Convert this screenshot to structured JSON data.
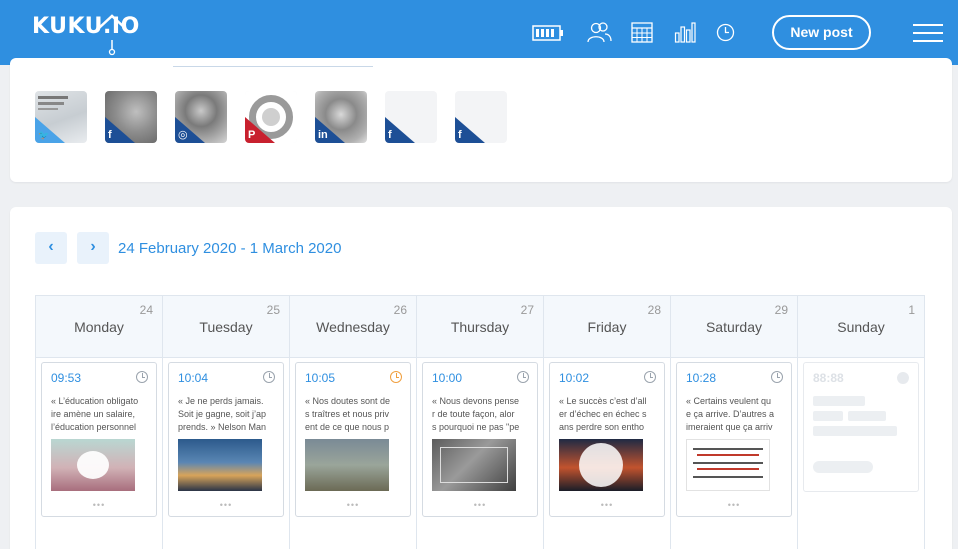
{
  "header": {
    "logo": "KUKU.IO",
    "nav_icons": [
      "battery-icon",
      "users-icon",
      "calendar-icon",
      "analytics-icon",
      "clock-icon"
    ],
    "new_post_label": "New post",
    "menu_icon": "hamburger-icon",
    "color": "#2f8fe0"
  },
  "accounts": [
    {
      "network": "twitter",
      "glyph": "🐦",
      "color": "#4aa3e8",
      "has_photo": true
    },
    {
      "network": "facebook",
      "glyph": "f",
      "color": "#1d4f96",
      "has_photo": true
    },
    {
      "network": "instagram",
      "glyph": "◎",
      "color": "#1d4f96",
      "has_photo": true
    },
    {
      "network": "pinterest",
      "glyph": "P",
      "color": "#c8202e",
      "has_photo": true
    },
    {
      "network": "linkedin",
      "glyph": "in",
      "color": "#1d4f96",
      "has_photo": true
    },
    {
      "network": "facebook",
      "glyph": "f",
      "color": "#1d4f96",
      "has_photo": false
    },
    {
      "network": "facebook",
      "glyph": "f",
      "color": "#1d4f96",
      "has_photo": false
    }
  ],
  "calendar": {
    "prev_label": "‹",
    "next_label": "›",
    "range": "24 February 2020 - 1 March 2020",
    "days": [
      {
        "date": "24",
        "name": "Monday",
        "post": {
          "time": "09:53",
          "text": "« L’éducation obligato\nire amène un salaire,\nl’éducation personnel",
          "status": "scheduled"
        }
      },
      {
        "date": "25",
        "name": "Tuesday",
        "post": {
          "time": "10:04",
          "text": "« Je ne perds jamais.\nSoit je gagne, soit j’ap\nprends. » Nelson Man",
          "status": "scheduled"
        }
      },
      {
        "date": "26",
        "name": "Wednesday",
        "post": {
          "time": "10:05",
          "text": "« Nos doutes sont de\ns traîtres et nous priv\nent de ce que nous p",
          "status": "warning"
        }
      },
      {
        "date": "27",
        "name": "Thursday",
        "post": {
          "time": "10:00",
          "text": "« Nous devons pense\nr de toute façon, alor\ns pourquoi ne pas \"pe",
          "status": "scheduled"
        }
      },
      {
        "date": "28",
        "name": "Friday",
        "post": {
          "time": "10:02",
          "text": "« Le succès c’est d’all\ner d’échec en échec s\nans perdre son entho",
          "status": "scheduled"
        }
      },
      {
        "date": "29",
        "name": "Saturday",
        "post": {
          "time": "10:28",
          "text": "« Certains veulent qu\ne ça arrive. D’autres a\nimeraient que ça arriv",
          "status": "scheduled"
        }
      },
      {
        "date": "1",
        "name": "Sunday",
        "placeholder_time": "88:88"
      }
    ],
    "more_label": "•••"
  }
}
